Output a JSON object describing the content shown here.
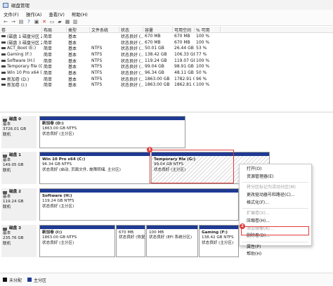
{
  "window": {
    "title": "磁盘管理"
  },
  "menu": [
    "文件(F)",
    "操作(A)",
    "查看(V)",
    "帮助(H)"
  ],
  "toolbar_icons": [
    "back-arrow-icon",
    "forward-arrow-icon",
    "list-view-icon",
    "help-icon",
    "properties-icon",
    "delete-icon",
    "open-icon",
    "new-folder-icon",
    "properties-sheet-icon",
    "volume-icon"
  ],
  "volume_table": {
    "headers": [
      "卷",
      "布局",
      "类型",
      "文件系统",
      "状态",
      "容量",
      "可用空间",
      "% 可用"
    ],
    "rows": [
      [
        "(磁盘 1 磁盘分区 2)",
        "简单",
        "基本",
        "",
        "状态良好 (...",
        "670 MB",
        "670 MB",
        "100 %"
      ],
      [
        "(磁盘 3 磁盘分区 2)",
        "简单",
        "基本",
        "",
        "状态良好 (...",
        "670 MB",
        "670 MB",
        "100 %"
      ],
      [
        "ACT_Boot (E:)",
        "简单",
        "基本",
        "NTFS",
        "状态良好 (...",
        "50.01 GB",
        "26.44 GB",
        "53 %"
      ],
      [
        "Gaming (F:)",
        "简单",
        "基本",
        "NTFS",
        "状态良好 (...",
        "138.42 GB",
        "106.33 GB",
        "77 %"
      ],
      [
        "Software (H:)",
        "简单",
        "基本",
        "NTFS",
        "状态良好 (...",
        "119.24 GB",
        "119.07 GB",
        "100 %"
      ],
      [
        "Temporary file (G:)",
        "简单",
        "基本",
        "NTFS",
        "状态良好 (...",
        "99.04 GB",
        "98.91 GB",
        "100 %"
      ],
      [
        "Win 10 Pro x64 (C:)",
        "简单",
        "基本",
        "NTFS",
        "状态良好 (...",
        "96.34 GB",
        "48.11 GB",
        "50 %"
      ],
      [
        "新加卷 (D:)",
        "简单",
        "基本",
        "NTFS",
        "状态良好 (...",
        "1863.00 GB",
        "1782.91 GB",
        "96 %"
      ],
      [
        "新加卷 (I:)",
        "简单",
        "基本",
        "NTFS",
        "状态良好 (...",
        "1863.00 GB",
        "1862.81 GB",
        "100 %"
      ]
    ]
  },
  "disks": [
    {
      "label": [
        "磁盘 0",
        "基本",
        "3726.01 GB",
        "联机"
      ],
      "partitions": [
        {
          "name": "新加卷 (D:)",
          "lines": [
            "1863.00 GB NTFS",
            "状态良好 (主分区)"
          ]
        }
      ]
    },
    {
      "label": [
        "磁盘 1",
        "基本",
        "149.05 GB",
        "联机"
      ],
      "partitions": [
        {
          "name": "Win 10 Pro x64 (C:)",
          "lines": [
            "96.34 GB NTFS",
            "状态良好 (启动, 页面文件, 故障转储, 主分区)"
          ]
        },
        {
          "name": "Temporary file (G:)",
          "lines": [
            "99.04 GB NTFS",
            "状态良好 (主分区)"
          ]
        }
      ]
    },
    {
      "label": [
        "磁盘 2",
        "基本",
        "119.24 GB",
        "联机"
      ],
      "partitions": [
        {
          "name": "Software (H:)",
          "lines": [
            "119.24 GB NTFS",
            "状态良好 (主分区)"
          ]
        }
      ]
    },
    {
      "label": [
        "磁盘 3",
        "基本",
        "235.76 GB",
        "联机"
      ],
      "partitions": [
        {
          "name": "新加卷 (I:)",
          "lines": [
            "1863.00 GB NTFS",
            "状态良好 (主分区)"
          ]
        },
        {
          "name": "",
          "lines": [
            "670 MB",
            "状态良好 (恢复分区)"
          ]
        },
        {
          "name": "",
          "lines": [
            "100 MB",
            "状态良好 (EFI 系统分区)"
          ]
        },
        {
          "name": "Gaming (F:)",
          "lines": [
            "138.42 GB NTFS",
            "状态良好 (主分区)"
          ]
        }
      ]
    }
  ],
  "context_menu": {
    "items": [
      {
        "label": "打开(O)",
        "disabled": false
      },
      {
        "label": "资源管理器(E)",
        "disabled": false
      },
      {
        "sep": true
      },
      {
        "label": "将分区标记为活动分区(M)",
        "disabled": true
      },
      {
        "label": "更改驱动器号和路径(C)...",
        "disabled": false
      },
      {
        "label": "格式化(F)...",
        "disabled": false
      },
      {
        "sep": true
      },
      {
        "label": "扩展卷(X)...",
        "disabled": true
      },
      {
        "label": "压缩卷(H)...",
        "disabled": false
      },
      {
        "label": "添加镜像(A)...",
        "disabled": true
      },
      {
        "label": "删除卷(D)...",
        "disabled": false
      },
      {
        "sep": true
      },
      {
        "label": "属性(P)",
        "disabled": false
      },
      {
        "label": "帮助(H)",
        "disabled": false
      }
    ]
  },
  "annotations": {
    "badge1": "1",
    "badge2": "2"
  },
  "legend": [
    {
      "label": "未分配",
      "color": "#111111"
    },
    {
      "label": "主分区",
      "color": "#1f3a93"
    }
  ],
  "colors": {
    "partition_bar": "#1f3a93",
    "highlight": "#e03a3a"
  }
}
